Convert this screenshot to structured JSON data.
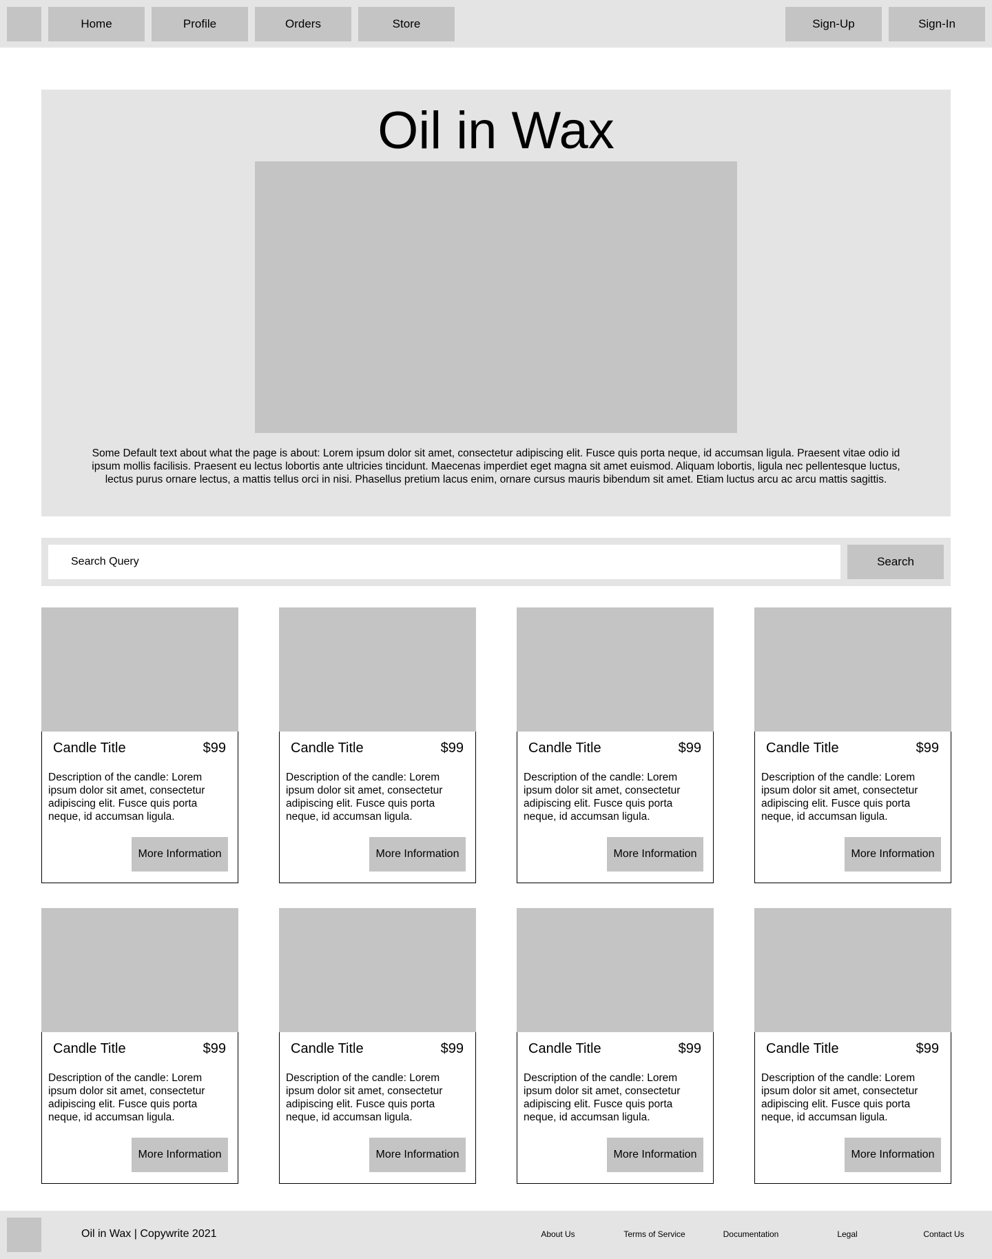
{
  "nav": {
    "logo_icon": "logo-placeholder",
    "left_items": [
      {
        "label": "Home"
      },
      {
        "label": "Profile"
      },
      {
        "label": "Orders"
      },
      {
        "label": "Store"
      }
    ],
    "right_items": [
      {
        "label": "Sign-Up"
      },
      {
        "label": "Sign-In"
      }
    ]
  },
  "hero": {
    "title": "Oil in Wax",
    "description": "Some Default text about what the page is about: Lorem ipsum dolor sit amet, consectetur adipiscing elit. Fusce quis porta neque, id accumsan ligula. Praesent vitae odio id ipsum mollis facilisis. Praesent eu lectus lobortis ante ultricies tincidunt. Maecenas imperdiet eget magna sit amet euismod. Aliquam lobortis, ligula nec pellentesque luctus, lectus purus ornare lectus, a mattis tellus orci in nisi. Phasellus pretium lacus enim, ornare cursus mauris bibendum sit amet. Etiam luctus arcu ac arcu mattis sagittis."
  },
  "search": {
    "placeholder": "Search Query",
    "value": "",
    "button_label": "Search"
  },
  "products": [
    {
      "title": "Candle Title",
      "price": "$99",
      "description": "Description of the candle: Lorem ipsum dolor sit amet, consectetur adipiscing elit. Fusce quis porta neque, id accumsan ligula.",
      "button_label": "More Information"
    },
    {
      "title": "Candle Title",
      "price": "$99",
      "description": "Description of the candle: Lorem ipsum dolor sit amet, consectetur adipiscing elit. Fusce quis porta neque, id accumsan ligula.",
      "button_label": "More Information"
    },
    {
      "title": "Candle Title",
      "price": "$99",
      "description": "Description of the candle: Lorem ipsum dolor sit amet, consectetur adipiscing elit. Fusce quis porta neque, id accumsan ligula.",
      "button_label": "More Information"
    },
    {
      "title": "Candle Title",
      "price": "$99",
      "description": "Description of the candle: Lorem ipsum dolor sit amet, consectetur adipiscing elit. Fusce quis porta neque, id accumsan ligula.",
      "button_label": "More Information"
    },
    {
      "title": "Candle Title",
      "price": "$99",
      "description": "Description of the candle: Lorem ipsum dolor sit amet, consectetur adipiscing elit. Fusce quis porta neque, id accumsan ligula.",
      "button_label": "More Information"
    },
    {
      "title": "Candle Title",
      "price": "$99",
      "description": "Description of the candle: Lorem ipsum dolor sit amet, consectetur adipiscing elit. Fusce quis porta neque, id accumsan ligula.",
      "button_label": "More Information"
    },
    {
      "title": "Candle Title",
      "price": "$99",
      "description": "Description of the candle: Lorem ipsum dolor sit amet, consectetur adipiscing elit. Fusce quis porta neque, id accumsan ligula.",
      "button_label": "More Information"
    },
    {
      "title": "Candle Title",
      "price": "$99",
      "description": "Description of the candle: Lorem ipsum dolor sit amet, consectetur adipiscing elit. Fusce quis porta neque, id accumsan ligula.",
      "button_label": "More Information"
    }
  ],
  "footer": {
    "logo_icon": "logo-placeholder",
    "copyright": "Oil in Wax | Copywrite 2021",
    "links": [
      {
        "label": "About Us"
      },
      {
        "label": "Terms of Service"
      },
      {
        "label": "Documentation"
      },
      {
        "label": "Legal"
      },
      {
        "label": "Contact Us"
      }
    ]
  },
  "colors": {
    "bar_background": "#e4e4e4",
    "placeholder_fill": "#c4c4c4",
    "page_background": "#ffffff",
    "text": "#000000"
  }
}
